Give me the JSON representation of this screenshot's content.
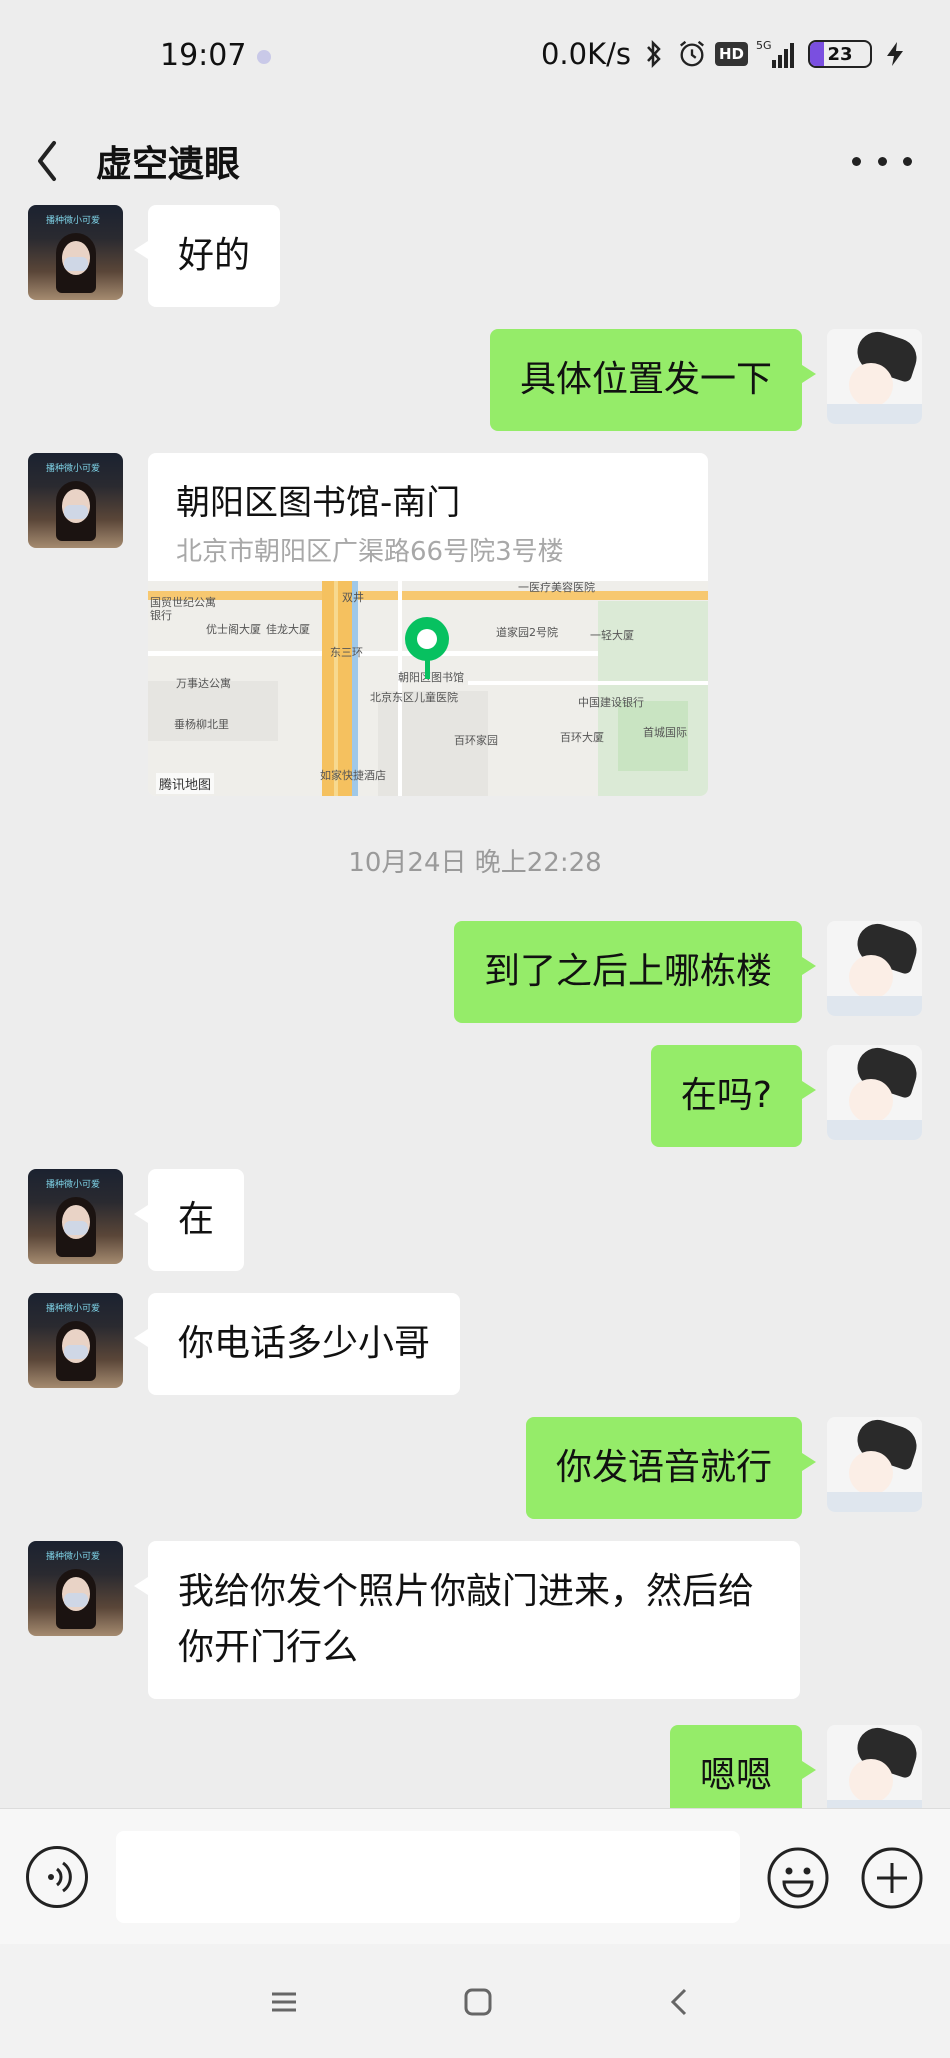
{
  "status_bar": {
    "time": "19:07",
    "network_speed": "0.0K/s",
    "hd": "HD",
    "signal": "5G",
    "battery": {
      "value": 23,
      "label": "23"
    }
  },
  "header": {
    "title": "虚空遗眼"
  },
  "messages": [
    {
      "side": "in",
      "type": "text",
      "text": "好的"
    },
    {
      "side": "out",
      "type": "text",
      "text": "具体位置发一下"
    },
    {
      "side": "in",
      "type": "location",
      "name": "朝阳区图书馆-南门",
      "address": "北京市朝阳区广渠路66号院3号楼",
      "map_provider": "腾讯地图",
      "map_labels": [
        "双井",
        "一医疗美容医院",
        "国贸世纪公寓",
        "银行",
        "优士阁大厦",
        "佳龙大厦",
        "东三环",
        "万事达公寓",
        "垂杨柳北里",
        "北京东区儿童医院",
        "朝阳区图书馆",
        "百环家园",
        "道家园2号院",
        "一轻大厦",
        "中国建设银行",
        "百环大厦",
        "首城国际",
        "如家快捷酒店"
      ]
    },
    {
      "side": "center",
      "type": "timestamp",
      "text": "10月24日 晚上22:28"
    },
    {
      "side": "out",
      "type": "text",
      "text": "到了之后上哪栋楼"
    },
    {
      "side": "out",
      "type": "text",
      "text": "在吗?"
    },
    {
      "side": "in",
      "type": "text",
      "text": "在"
    },
    {
      "side": "in",
      "type": "text",
      "text": "你电话多少小哥"
    },
    {
      "side": "out",
      "type": "text",
      "text": "你发语音就行"
    },
    {
      "side": "in",
      "type": "text",
      "text": "我给你发个照片你敲门进来，然后给你开门行么"
    },
    {
      "side": "out",
      "type": "text",
      "text": "嗯嗯"
    }
  ],
  "input_bar": {
    "value": "",
    "placeholder": ""
  },
  "colors": {
    "background": "#ededed",
    "outgoing_bubble": "#95ec69",
    "incoming_bubble": "#ffffff",
    "map_pin": "#07c160"
  }
}
